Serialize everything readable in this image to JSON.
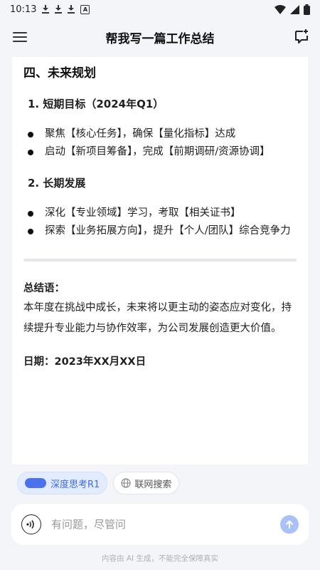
{
  "status_bar": {
    "time": "10:13"
  },
  "app_bar": {
    "title": "帮我写一篇工作总结"
  },
  "document": {
    "heading": "四、未来规划",
    "sections": [
      {
        "title": "1. 短期目标（2024年Q1）",
        "bullets": [
          "聚焦【核心任务】，确保【量化指标】达成",
          "启动【新项目筹备】，完成【前期调研/资源协调】"
        ]
      },
      {
        "title": "2. 长期发展",
        "bullets": [
          "深化【专业领域】学习，考取【相关证书】",
          "探索【业务拓展方向】，提升【个人/团队】综合竞争力"
        ]
      }
    ],
    "summary_label": "总结语：",
    "summary_text": "本年度在挑战中成长，未来将以更主动的姿态应对变化，持续提升专业能力与协作效率，为公司发展创造更大价值。",
    "date_line": "日期：2023年XX月XX日"
  },
  "chips": {
    "deep_think": "深度思考R1",
    "web_search": "联网搜索"
  },
  "input": {
    "placeholder": "有问题，尽管问"
  },
  "footer_note": "内容由 AI 生成，不能完全保障真实",
  "colors": {
    "accent": "#4a72ee",
    "chip_active_bg": "#e3ecff",
    "send_button": "#a9c1f5"
  }
}
